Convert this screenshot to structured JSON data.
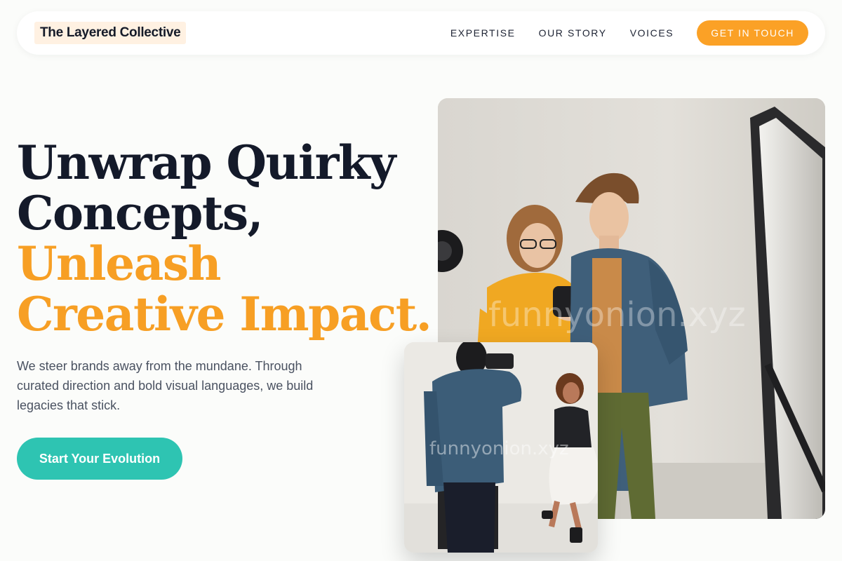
{
  "header": {
    "brand": "The Layered Collective",
    "nav": [
      {
        "label": "EXPERTISE"
      },
      {
        "label": "OUR STORY"
      },
      {
        "label": "VOICES"
      }
    ],
    "cta_label": "GET IN TOUCH"
  },
  "hero": {
    "headline_line1": "Unwrap Quirky",
    "headline_line2": "Concepts,",
    "headline_line3": "Unleash",
    "headline_line4": "Creative Impact.",
    "subtext": "We steer brands away from the mundane. Through curated direction and bold visual languages, we build legacies that stick.",
    "button_label": "Start Your Evolution"
  },
  "photos": {
    "main_watermark": "funnyonion.xyz",
    "small_watermark": "funnyonion.xyz"
  },
  "colors": {
    "accent_orange": "#f79f24",
    "button_teal": "#2ec4b2",
    "text_dark": "#141a2a",
    "background": "#fbfcfa"
  }
}
